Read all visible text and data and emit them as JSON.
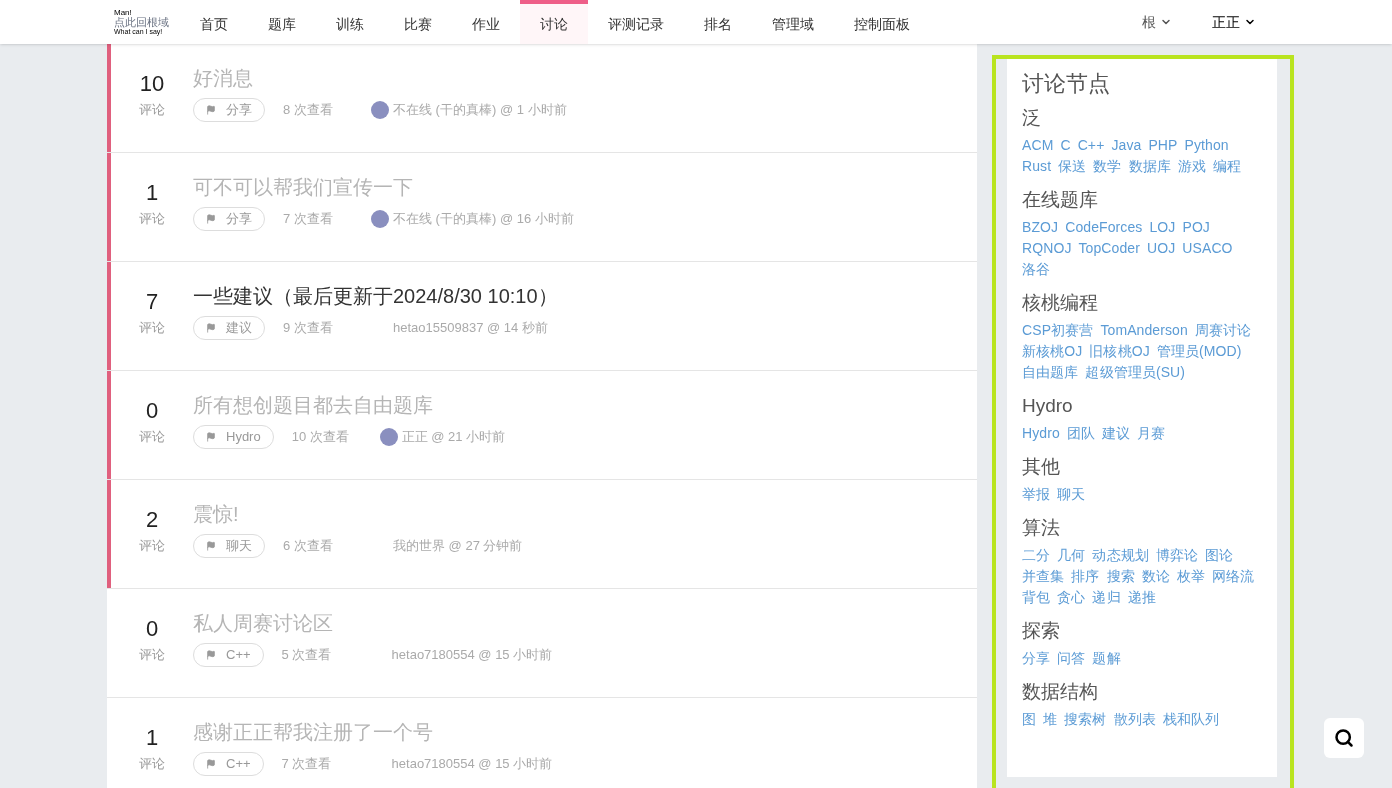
{
  "logo": {
    "top": "Man!",
    "middle": "点此回根域",
    "bottom": "What can I say!"
  },
  "nav": [
    {
      "label": "首页",
      "selected": false
    },
    {
      "label": "题库",
      "selected": false
    },
    {
      "label": "训练",
      "selected": false
    },
    {
      "label": "比赛",
      "selected": false
    },
    {
      "label": "作业",
      "selected": false
    },
    {
      "label": "讨论",
      "selected": true
    },
    {
      "label": "评测记录",
      "selected": false
    },
    {
      "label": "排名",
      "selected": false
    },
    {
      "label": "管理域",
      "selected": false
    },
    {
      "label": "控制面板",
      "selected": false
    }
  ],
  "nav_right": [
    {
      "label": "根",
      "bold": false
    },
    {
      "label": "正正",
      "bold": true
    }
  ],
  "discussions": [
    {
      "count": "10",
      "count_label": "评论",
      "title": "好消息",
      "visited": true,
      "highlighted": true,
      "node": "分享",
      "views": "8 次查看",
      "avatar": true,
      "author": "不在线 (干的真棒) @ 1 小时前"
    },
    {
      "count": "1",
      "count_label": "评论",
      "title": "可不可以帮我们宣传一下",
      "visited": true,
      "highlighted": true,
      "node": "分享",
      "views": "7 次查看",
      "avatar": true,
      "author": "不在线 (干的真棒) @ 16 小时前"
    },
    {
      "count": "7",
      "count_label": "评论",
      "title": "一些建议（最后更新于2024/8/30 10:10）",
      "visited": false,
      "highlighted": true,
      "node": "建议",
      "views": "9 次查看",
      "avatar": false,
      "author": "hetao15509837 @ 14 秒前"
    },
    {
      "count": "0",
      "count_label": "评论",
      "title": "所有想创题目都去自由题库",
      "visited": true,
      "highlighted": true,
      "node": "Hydro",
      "views": "10 次查看",
      "avatar": true,
      "author": "正正 @ 21 小时前"
    },
    {
      "count": "2",
      "count_label": "评论",
      "title": "震惊!",
      "visited": true,
      "highlighted": true,
      "node": "聊天",
      "views": "6 次查看",
      "avatar": false,
      "author": "我的世界 @ 27 分钟前"
    },
    {
      "count": "0",
      "count_label": "评论",
      "title": "私人周赛讨论区",
      "visited": true,
      "highlighted": false,
      "node": "C++",
      "views": "5 次查看",
      "avatar": false,
      "author": "hetao7180554 @ 15 小时前"
    },
    {
      "count": "1",
      "count_label": "评论",
      "title": "感谢正正帮我注册了一个号",
      "visited": true,
      "highlighted": false,
      "node": "C++",
      "views": "7 次查看",
      "avatar": false,
      "author": "hetao7180554 @ 15 小时前"
    }
  ],
  "sidebar": {
    "title": "讨论节点",
    "groups": [
      {
        "name": "泛",
        "nodes": [
          "ACM",
          "C",
          "C++",
          "Java",
          "PHP",
          "Python",
          "Rust",
          "保送",
          "数学",
          "数据库",
          "游戏",
          "编程"
        ]
      },
      {
        "name": "在线题库",
        "nodes": [
          "BZOJ",
          "CodeForces",
          "LOJ",
          "POJ",
          "RQNOJ",
          "TopCoder",
          "UOJ",
          "USACO",
          "洛谷"
        ]
      },
      {
        "name": "核桃编程",
        "nodes": [
          "CSP初赛营",
          "TomAnderson",
          "周赛讨论",
          "新核桃OJ",
          "旧核桃OJ",
          "管理员(MOD)",
          "自由题库",
          "超级管理员(SU)"
        ]
      },
      {
        "name": "Hydro",
        "nodes": [
          "Hydro",
          "团队",
          "建议",
          "月赛"
        ]
      },
      {
        "name": "其他",
        "nodes": [
          "举报",
          "聊天"
        ]
      },
      {
        "name": "算法",
        "nodes": [
          "二分",
          "几何",
          "动态规划",
          "博弈论",
          "图论",
          "并查集",
          "排序",
          "搜索",
          "数论",
          "枚举",
          "网络流",
          "背包",
          "贪心",
          "递归",
          "递推"
        ]
      },
      {
        "name": "探索",
        "nodes": [
          "分享",
          "问答",
          "题解"
        ]
      },
      {
        "name": "数据结构",
        "nodes": [
          "图",
          "堆",
          "搜索树",
          "散列表",
          "栈和队列"
        ]
      }
    ]
  }
}
